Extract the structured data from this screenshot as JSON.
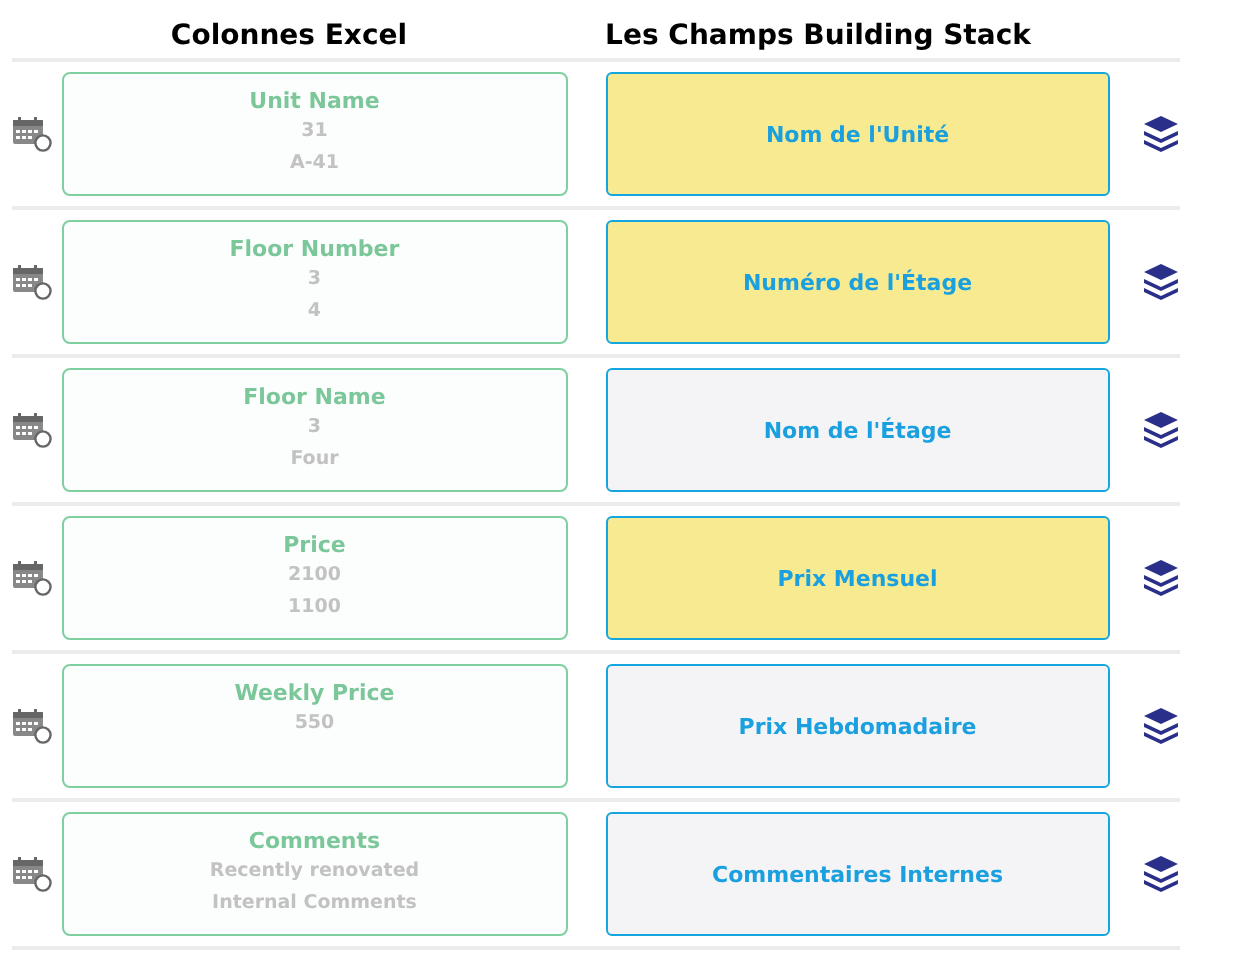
{
  "headers": {
    "excel": "Colonnes Excel",
    "target": "Les Champs Building Stack"
  },
  "rows": [
    {
      "column": "Unit Name",
      "samples": [
        "31",
        "A-41"
      ],
      "field": "Nom de l'Unité",
      "highlighted": true
    },
    {
      "column": "Floor Number",
      "samples": [
        "3",
        "4"
      ],
      "field": "Numéro de l'Étage",
      "highlighted": true
    },
    {
      "column": "Floor Name",
      "samples": [
        "3",
        "Four"
      ],
      "field": "Nom de l'Étage",
      "highlighted": false
    },
    {
      "column": "Price",
      "samples": [
        "2100",
        "1100"
      ],
      "field": "Prix Mensuel",
      "highlighted": true
    },
    {
      "column": "Weekly Price",
      "samples": [
        "550"
      ],
      "field": "Prix Hebdomadaire",
      "highlighted": false
    },
    {
      "column": "Comments",
      "samples": [
        "Recently renovated",
        "Internal Comments"
      ],
      "field": "Commentaires Internes",
      "highlighted": false
    }
  ]
}
